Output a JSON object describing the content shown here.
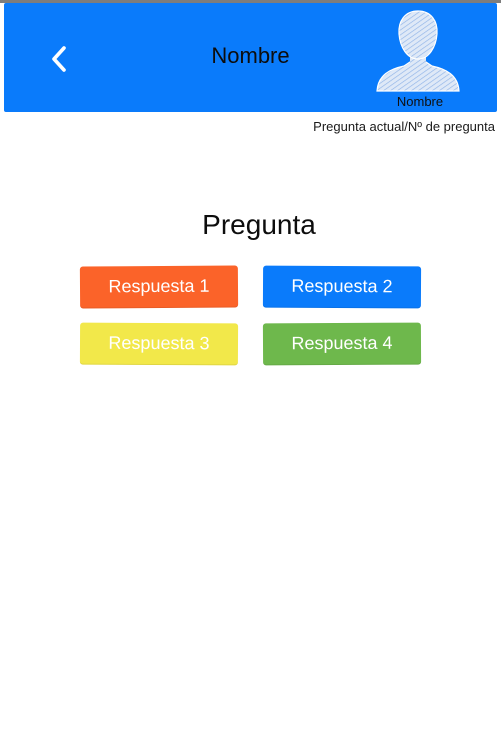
{
  "header": {
    "title": "Nombre",
    "back_icon": "chevron-left-icon",
    "avatar_icon": "user-avatar-icon",
    "avatar_label": "Nombre",
    "background_color": "#0a7bfb"
  },
  "progress_label": "Pregunta actual/Nº de pregunta",
  "question": "Pregunta",
  "answers": [
    {
      "label": "Respuesta 1",
      "color": "#fb6329"
    },
    {
      "label": "Respuesta 2",
      "color": "#0a7bfb"
    },
    {
      "label": "Respuesta 3",
      "color": "#f2e84a"
    },
    {
      "label": "Respuesta 4",
      "color": "#6eb84c"
    }
  ]
}
